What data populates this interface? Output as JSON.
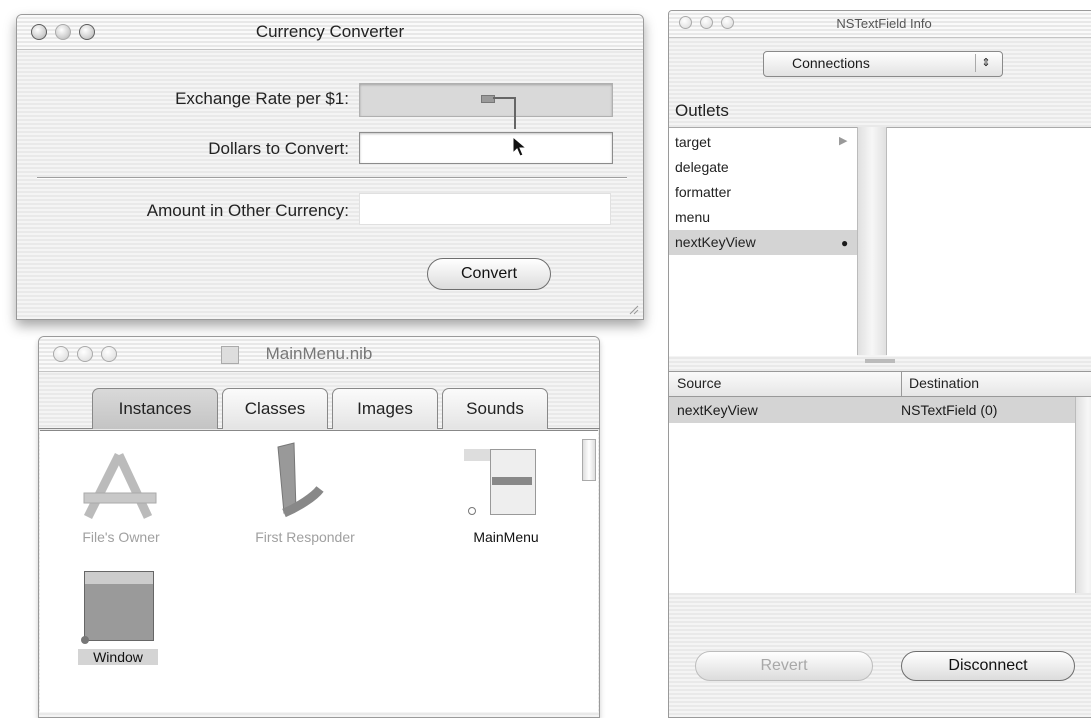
{
  "converter": {
    "title": "Currency Converter",
    "exchange_label": "Exchange Rate per $1:",
    "dollars_label": "Dollars to Convert:",
    "amount_label": "Amount in Other Currency:",
    "convert_button": "Convert"
  },
  "nib": {
    "title": "MainMenu.nib",
    "tabs": [
      "Instances",
      "Classes",
      "Images",
      "Sounds"
    ],
    "active_tab": "Instances",
    "instances": [
      {
        "label": "File's Owner",
        "icon": "app-icon"
      },
      {
        "label": "First Responder",
        "icon": "first-responder-icon"
      },
      {
        "label": "MainMenu",
        "icon": "main-menu-icon"
      },
      {
        "label": "Window",
        "icon": "window-icon"
      }
    ]
  },
  "info": {
    "title": "NSTextField Info",
    "popup": "Connections",
    "outlets_header": "Outlets",
    "outlets": [
      "target",
      "delegate",
      "formatter",
      "menu",
      "nextKeyView"
    ],
    "selected_outlet": "nextKeyView",
    "columns": [
      "Source",
      "Destination"
    ],
    "connection": {
      "source": "nextKeyView",
      "destination": "NSTextField (0)"
    },
    "revert_button": "Revert",
    "disconnect_button": "Disconnect"
  },
  "colors": {
    "selection": "#d4d4d4",
    "active_tab": "#c8c8c8"
  }
}
